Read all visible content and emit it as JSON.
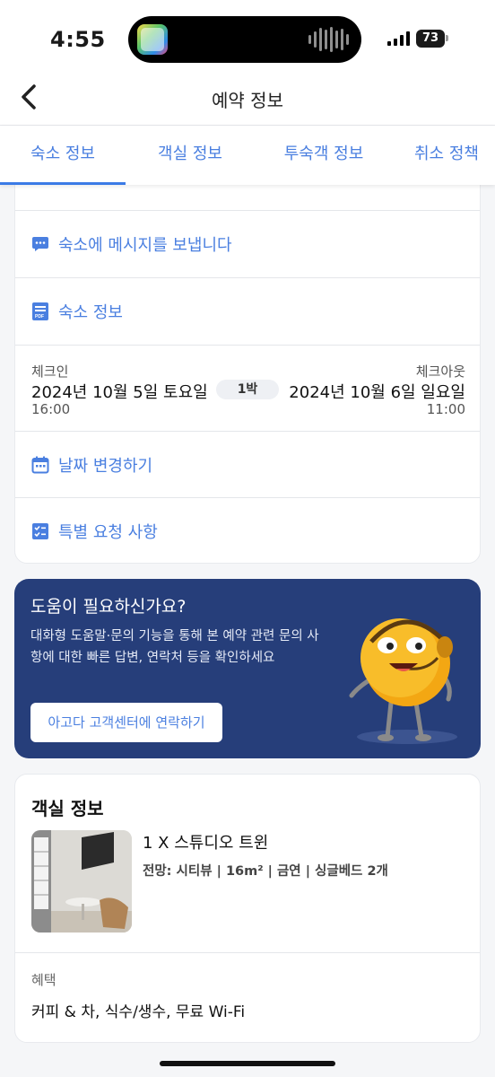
{
  "status_bar": {
    "time": "4:55",
    "battery": "73",
    "icons": [
      "app-icon",
      "audio-wave-icon",
      "signal-icon",
      "battery-icon"
    ]
  },
  "header": {
    "title": "예약 정보",
    "back_icon": "chevron-left-icon"
  },
  "tabs": [
    {
      "label": "숙소 정보",
      "active": true
    },
    {
      "label": "객실 정보",
      "active": false
    },
    {
      "label": "투숙객 정보",
      "active": false
    },
    {
      "label": "취소 정책",
      "active": false
    }
  ],
  "booking": {
    "message_link": {
      "label": "숙소에 메시지를 보냅니다",
      "icon": "message-icon"
    },
    "property_info_link": {
      "label": "숙소 정보",
      "icon": "pdf-icon"
    },
    "check_in": {
      "label": "체크인",
      "date": "2024년 10월 5일 토요일",
      "time": "16:00"
    },
    "check_out": {
      "label": "체크아웃",
      "date": "2024년 10월 6일 일요일",
      "time": "11:00"
    },
    "nights": "1박",
    "change_dates_link": {
      "label": "날짜 변경하기",
      "icon": "calendar-icon"
    },
    "special_requests_link": {
      "label": "특별 요청 사항",
      "icon": "checklist-icon"
    }
  },
  "help": {
    "title": "도움이 필요하신가요?",
    "description": "대화형 도움말·문의 기능을 통해 본 예약 관련 문의 사항에 대한 빠른 답변, 연락처 등을 확인하세요",
    "button_label": "아고다 고객센터에 연락하기",
    "mascot": "support-mascot-icon"
  },
  "room": {
    "section_title": "객실 정보",
    "name": "1 X 스튜디오 트윈",
    "details": "전망: 시티뷰 | 16m² | 금연 | 싱글베드 2개",
    "benefits_label": "혜택",
    "benefits": "커피 & 차, 식수/생수, 무료 Wi-Fi"
  },
  "colors": {
    "accent": "#4a7fe0",
    "help_banner": "#263e7a",
    "background": "#f5f6f8"
  }
}
